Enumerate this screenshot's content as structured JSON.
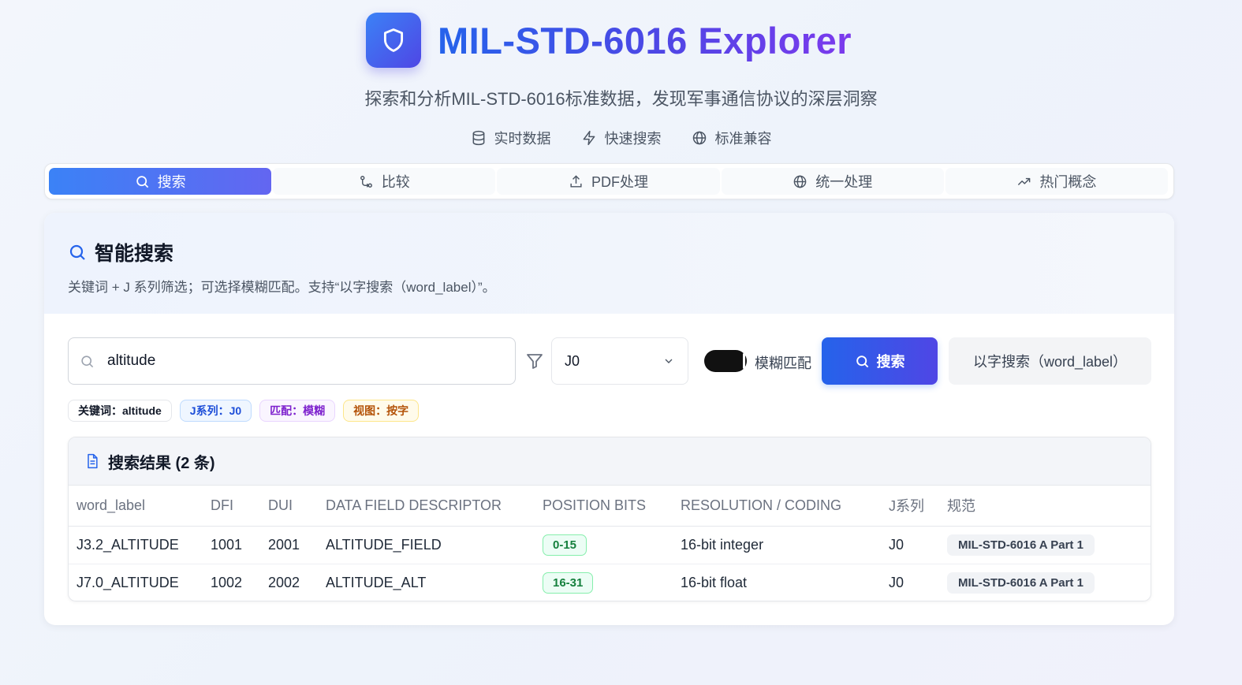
{
  "app": {
    "title": "MIL-STD-6016 Explorer",
    "subtitle": "探索和分析MIL-STD-6016标准数据，发现军事通信协议的深层洞察",
    "brand_gradient": [
      "#2563eb",
      "#4f46e5",
      "#7c3aed"
    ]
  },
  "features": [
    {
      "icon": "database-icon",
      "label": "实时数据"
    },
    {
      "icon": "lightning-icon",
      "label": "快速搜索"
    },
    {
      "icon": "globe-icon",
      "label": "标准兼容"
    }
  ],
  "tabs": [
    {
      "icon": "search-icon",
      "label": "搜索",
      "active": true
    },
    {
      "icon": "compare-icon",
      "label": "比较",
      "active": false
    },
    {
      "icon": "upload-icon",
      "label": "PDF处理",
      "active": false
    },
    {
      "icon": "globe-icon",
      "label": "统一处理",
      "active": false
    },
    {
      "icon": "trending-icon",
      "label": "热门概念",
      "active": false
    }
  ],
  "panel": {
    "title": "智能搜索",
    "description": "关键词 + J 系列筛选；可选择模糊匹配。支持“以字搜索（word_label）”。"
  },
  "search": {
    "value": "altitude",
    "placeholder": "",
    "j_series_selected": "J0",
    "fuzzy_label": "模糊匹配",
    "fuzzy_enabled": true,
    "search_button": "搜索",
    "word_search_button": "以字搜索（word_label）"
  },
  "chips": [
    {
      "label": "关键词：altitude",
      "color": "#111827",
      "bg": "#ffffff",
      "border": "#e5e7eb"
    },
    {
      "label": "J系列：J0",
      "color": "#1d4ed8",
      "bg": "#eff6ff",
      "border": "#bfdbfe"
    },
    {
      "label": "匹配：模糊",
      "color": "#7e22ce",
      "bg": "#faf5ff",
      "border": "#e9d5ff"
    },
    {
      "label": "视图：按字",
      "color": "#b45309",
      "bg": "#fffbeb",
      "border": "#fde68a"
    }
  ],
  "results": {
    "title": "搜索结果 (2 条)",
    "columns": [
      "word_label",
      "DFI",
      "DUI",
      "DATA FIELD DESCRIPTOR",
      "POSITION BITS",
      "RESOLUTION / CODING",
      "J系列",
      "规范"
    ],
    "rows": [
      {
        "word_label": "J3.2_ALTITUDE",
        "dfi": "1001",
        "dui": "2001",
        "descriptor": "ALTITUDE_FIELD",
        "bits": "0-15",
        "resolution": "16-bit integer",
        "j_series": "J0",
        "spec": "MIL-STD-6016 A Part 1"
      },
      {
        "word_label": "J7.0_ALTITUDE",
        "dfi": "1002",
        "dui": "2002",
        "descriptor": "ALTITUDE_ALT",
        "bits": "16-31",
        "resolution": "16-bit float",
        "j_series": "J0",
        "spec": "MIL-STD-6016 A Part 1"
      }
    ]
  }
}
